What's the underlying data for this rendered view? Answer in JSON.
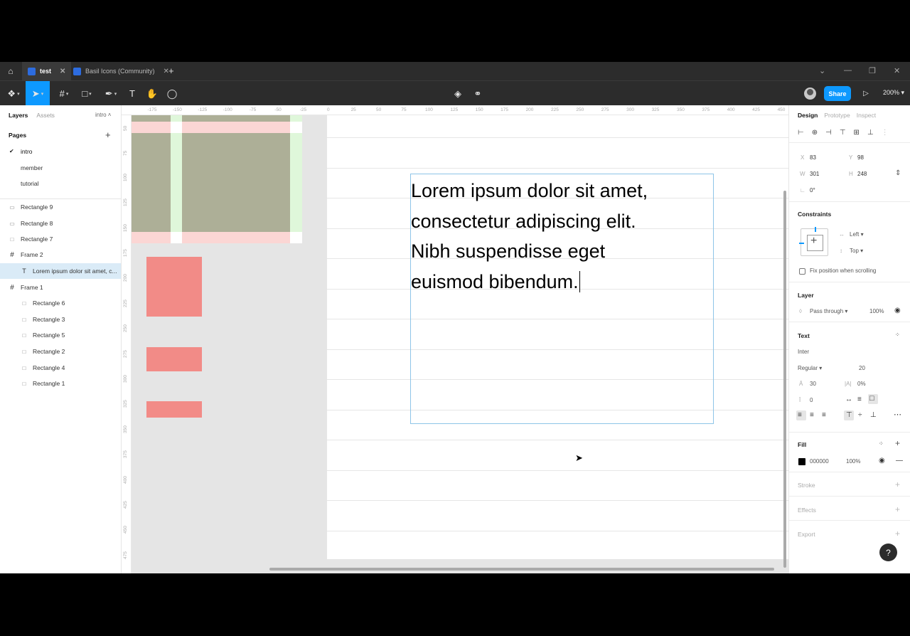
{
  "tabs": [
    {
      "label": "test",
      "active": true
    },
    {
      "label": "Basil Icons (Community)",
      "active": false
    }
  ],
  "toolbar": {
    "share_label": "Share",
    "zoom": "200%"
  },
  "left_panel": {
    "tab_layers": "Layers",
    "tab_assets": "Assets",
    "current_page": "intro",
    "pages_heading": "Pages",
    "pages": [
      "intro",
      "member",
      "tutorial"
    ],
    "layers": [
      {
        "name": "Rectangle 9",
        "type": "rect"
      },
      {
        "name": "Rectangle 8",
        "type": "rect"
      },
      {
        "name": "Rectangle 7",
        "type": "rect"
      },
      {
        "name": "Frame 2",
        "type": "frame"
      },
      {
        "name": "Lorem ipsum dolor sit amet, c...",
        "type": "text",
        "selected": true
      },
      {
        "name": "Frame 1",
        "type": "frame"
      },
      {
        "name": "Rectangle 6",
        "type": "rect"
      },
      {
        "name": "Rectangle 3",
        "type": "rect"
      },
      {
        "name": "Rectangle 5",
        "type": "rect"
      },
      {
        "name": "Rectangle 2",
        "type": "rect"
      },
      {
        "name": "Rectangle 4",
        "type": "rect"
      },
      {
        "name": "Rectangle 1",
        "type": "rect"
      }
    ]
  },
  "canvas": {
    "text_lines": [
      "Lorem ipsum dolor sit amet,",
      "consectetur adipiscing elit.",
      "Nibh suspendisse eget",
      "euismod bibendum."
    ],
    "ruler_top": [
      "-175",
      "-150",
      "-125",
      "-100",
      "-75",
      "-50",
      "-25",
      "0",
      "25",
      "50",
      "75",
      "100",
      "125",
      "150",
      "175",
      "200",
      "225",
      "250",
      "275",
      "300",
      "325",
      "350",
      "375",
      "400",
      "425",
      "450"
    ],
    "ruler_left": [
      "50",
      "75",
      "100",
      "125",
      "150",
      "175",
      "200",
      "225",
      "250",
      "275",
      "300",
      "325",
      "350",
      "375",
      "400",
      "425",
      "450",
      "475"
    ]
  },
  "right_panel": {
    "tab_design": "Design",
    "tab_prototype": "Prototype",
    "tab_inspect": "Inspect",
    "x_label": "X",
    "x": "83",
    "y_label": "Y",
    "y": "98",
    "w_label": "W",
    "w": "301",
    "h_label": "H",
    "h": "248",
    "rotation": "0°",
    "constraints_heading": "Constraints",
    "constraint_h": "Left",
    "constraint_v": "Top",
    "fix_position": "Fix position when scrolling",
    "layer_heading": "Layer",
    "blend": "Pass through",
    "opacity": "100%",
    "text_heading": "Text",
    "font_family": "Inter",
    "font_weight": "Regular",
    "font_size": "20",
    "line_height": "30",
    "letter_spacing": "0%",
    "paragraph_spacing": "0",
    "fill_heading": "Fill",
    "fill_hex": "000000",
    "fill_opacity": "100%",
    "stroke_heading": "Stroke",
    "effects_heading": "Effects",
    "export_heading": "Export"
  },
  "colors": {
    "accent": "#0d99ff",
    "rect_pink": "#f28b87",
    "rect_olive": "#adaf97"
  }
}
